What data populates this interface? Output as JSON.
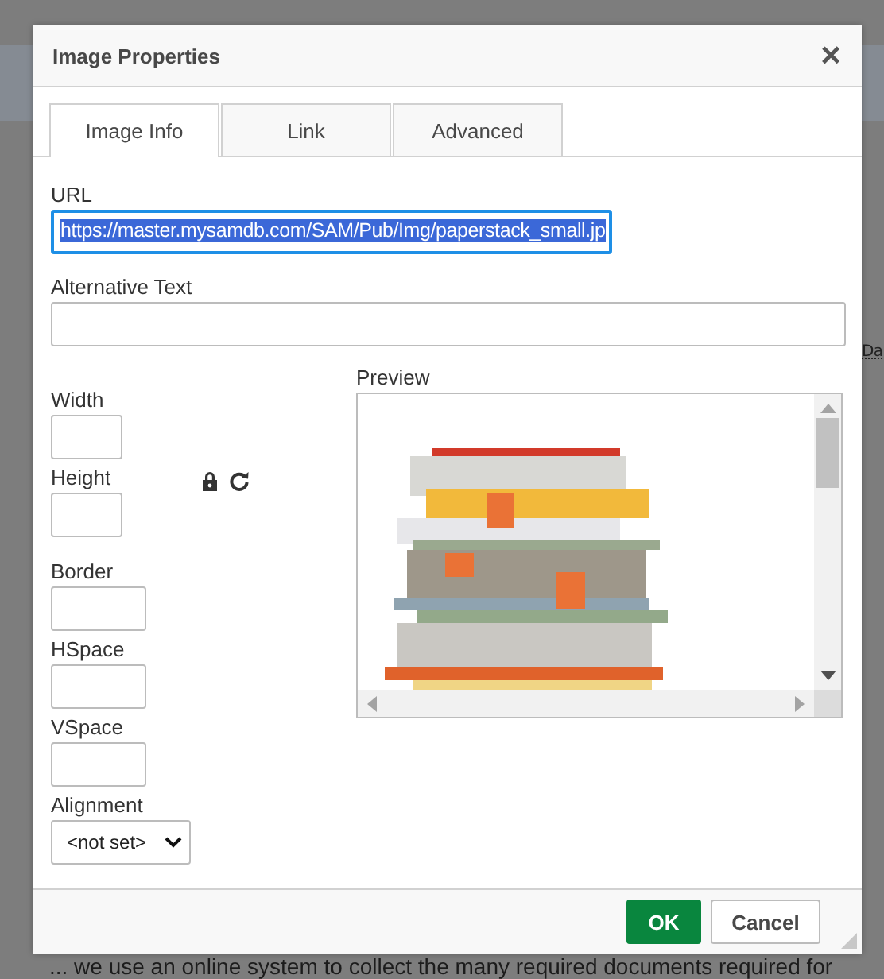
{
  "background": {
    "fragment": "Da",
    "paragraph": "... we use an online system to collect the many required documents required for"
  },
  "dialog": {
    "title": "Image Properties",
    "close": "×"
  },
  "tabs": [
    {
      "label": "Image Info",
      "selected": true
    },
    {
      "label": "Link",
      "selected": false
    },
    {
      "label": "Advanced",
      "selected": false
    }
  ],
  "url": {
    "label": "URL",
    "value": "https://master.mysamdb.com/SAM/Pub/Img/paperstack_small.jp",
    "focused": true
  },
  "alt_text": {
    "label": "Alternative Text"
  },
  "size_fields": [
    {
      "label": "Width"
    },
    {
      "label": "Height"
    }
  ],
  "spacing_fields": [
    {
      "label": "Border"
    },
    {
      "label": "HSpace"
    },
    {
      "label": "VSpace"
    }
  ],
  "alignment": {
    "label": "Alignment",
    "value": "<not set>"
  },
  "preview": {
    "label": "Preview"
  },
  "buttons": [
    {
      "label": "OK",
      "kind": "primary"
    },
    {
      "label": "Cancel",
      "kind": "secondary"
    }
  ]
}
